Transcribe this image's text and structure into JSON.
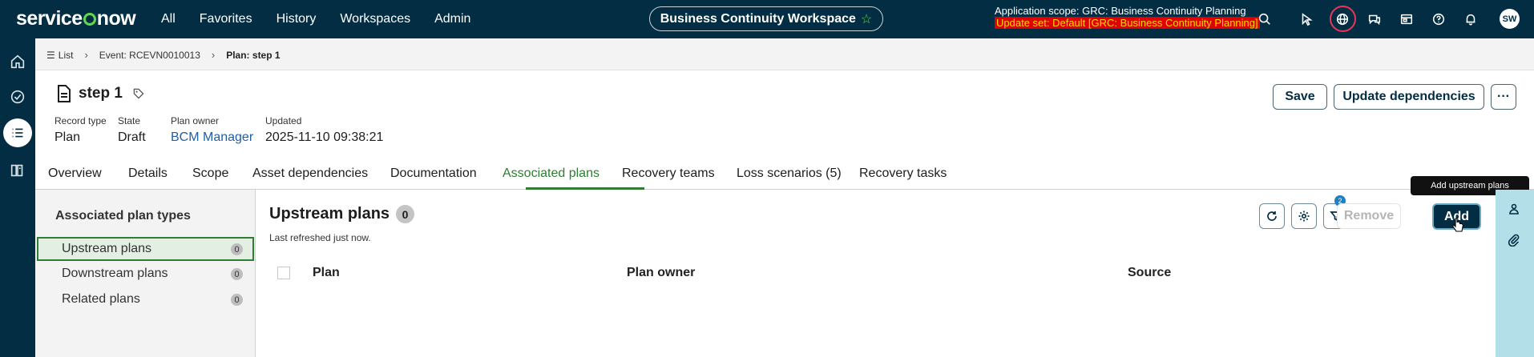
{
  "topnav": {
    "logo": "servicenow",
    "links": [
      "All",
      "Favorites",
      "History",
      "Workspaces",
      "Admin"
    ],
    "workspace": "Business Continuity Workspace",
    "scope_line": "Application scope: GRC: Business Continuity Planning",
    "update_set_line": "Update set: Default [GRC: Business Continuity Planning]",
    "avatar_initials": "SW",
    "icons": [
      "search-icon",
      "pointer-icon",
      "globe-icon",
      "chat-icon",
      "inbox-icon",
      "help-icon",
      "bell-icon"
    ]
  },
  "breadcrumb": {
    "list": "List",
    "event": "Event: RCEVN0010013",
    "current": "Plan: step 1"
  },
  "record": {
    "title": "step 1",
    "fields": [
      {
        "label": "Record type",
        "value": "Plan"
      },
      {
        "label": "State",
        "value": "Draft"
      },
      {
        "label": "Plan owner",
        "value": "BCM Manager"
      },
      {
        "label": "Updated",
        "value": "2025-11-10 09:38:21"
      }
    ],
    "save_label": "Save",
    "update_deps_label": "Update dependencies",
    "more_label": "···"
  },
  "tabs": [
    "Overview",
    "Details",
    "Scope",
    "Asset dependencies",
    "Documentation",
    "Associated plans",
    "Recovery teams",
    "Loss scenarios (5)",
    "Recovery tasks"
  ],
  "active_tab": "Associated plans",
  "left_panel": {
    "heading": "Associated plan types",
    "items": [
      {
        "label": "Upstream plans",
        "count": "0"
      },
      {
        "label": "Downstream plans",
        "count": "0"
      },
      {
        "label": "Related plans",
        "count": "0"
      }
    ]
  },
  "main": {
    "title": "Upstream plans",
    "count": "0",
    "refreshed": "Last refreshed just now.",
    "filter_count": "2",
    "remove_label": "Remove",
    "add_label": "Add",
    "tooltip": "Add upstream plans",
    "columns": [
      "Plan",
      "Plan owner",
      "Source"
    ]
  },
  "colors": {
    "nav_bg": "#032d42",
    "accent_green": "#2e7d32",
    "right_rail": "#b3dfe8"
  }
}
